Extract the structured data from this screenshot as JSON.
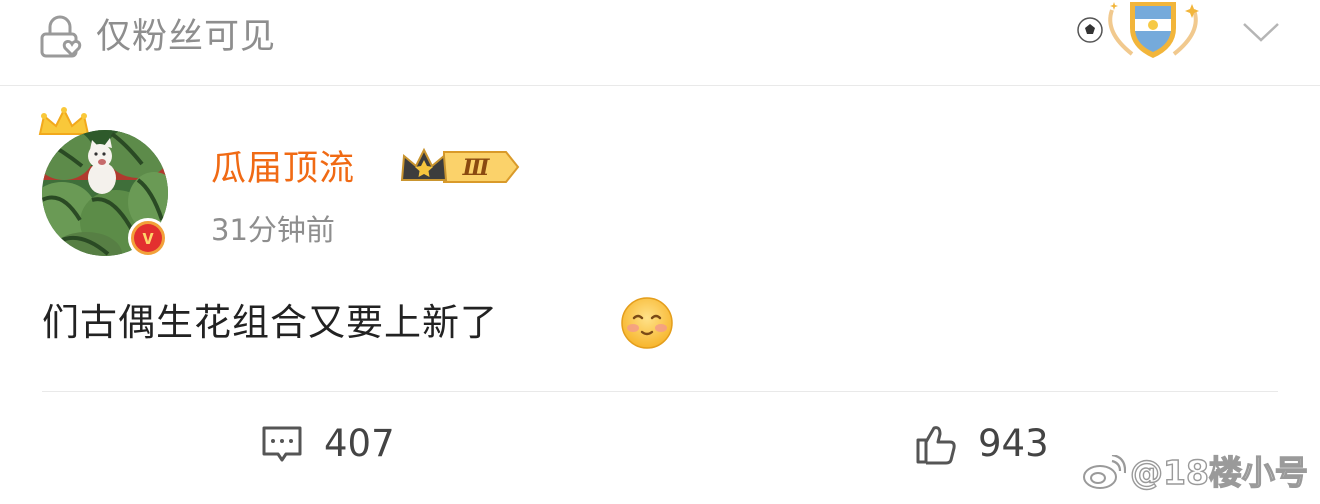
{
  "header": {
    "visibility_icon": "lock-heart-icon",
    "visibility_label": "仅粉丝可见",
    "fan_badge_icon": "argentina-shield-soccer-icon",
    "expand_icon": "chevron-down-icon"
  },
  "post": {
    "avatar": "cat-on-watermelons-avatar",
    "verified_icon": "v-verified-icon",
    "username": "瓜届顶流",
    "member_badge": {
      "icon": "crown-icon",
      "level": "Ⅲ"
    },
    "time": "31分钟前",
    "text": "们古偶生花组合又要上新了",
    "emoji": "blush-emoji"
  },
  "actions": {
    "comment": {
      "icon": "comment-icon",
      "count": "407"
    },
    "like": {
      "icon": "thumbs-up-icon",
      "count": "943"
    }
  },
  "watermark": {
    "logo": "weibo-logo-icon",
    "text": "@18楼小号"
  },
  "colors": {
    "username": "#f06a14",
    "muted": "#8e8e8e",
    "badge_gold": "#f2b53a",
    "verified_red": "#e3302f"
  }
}
